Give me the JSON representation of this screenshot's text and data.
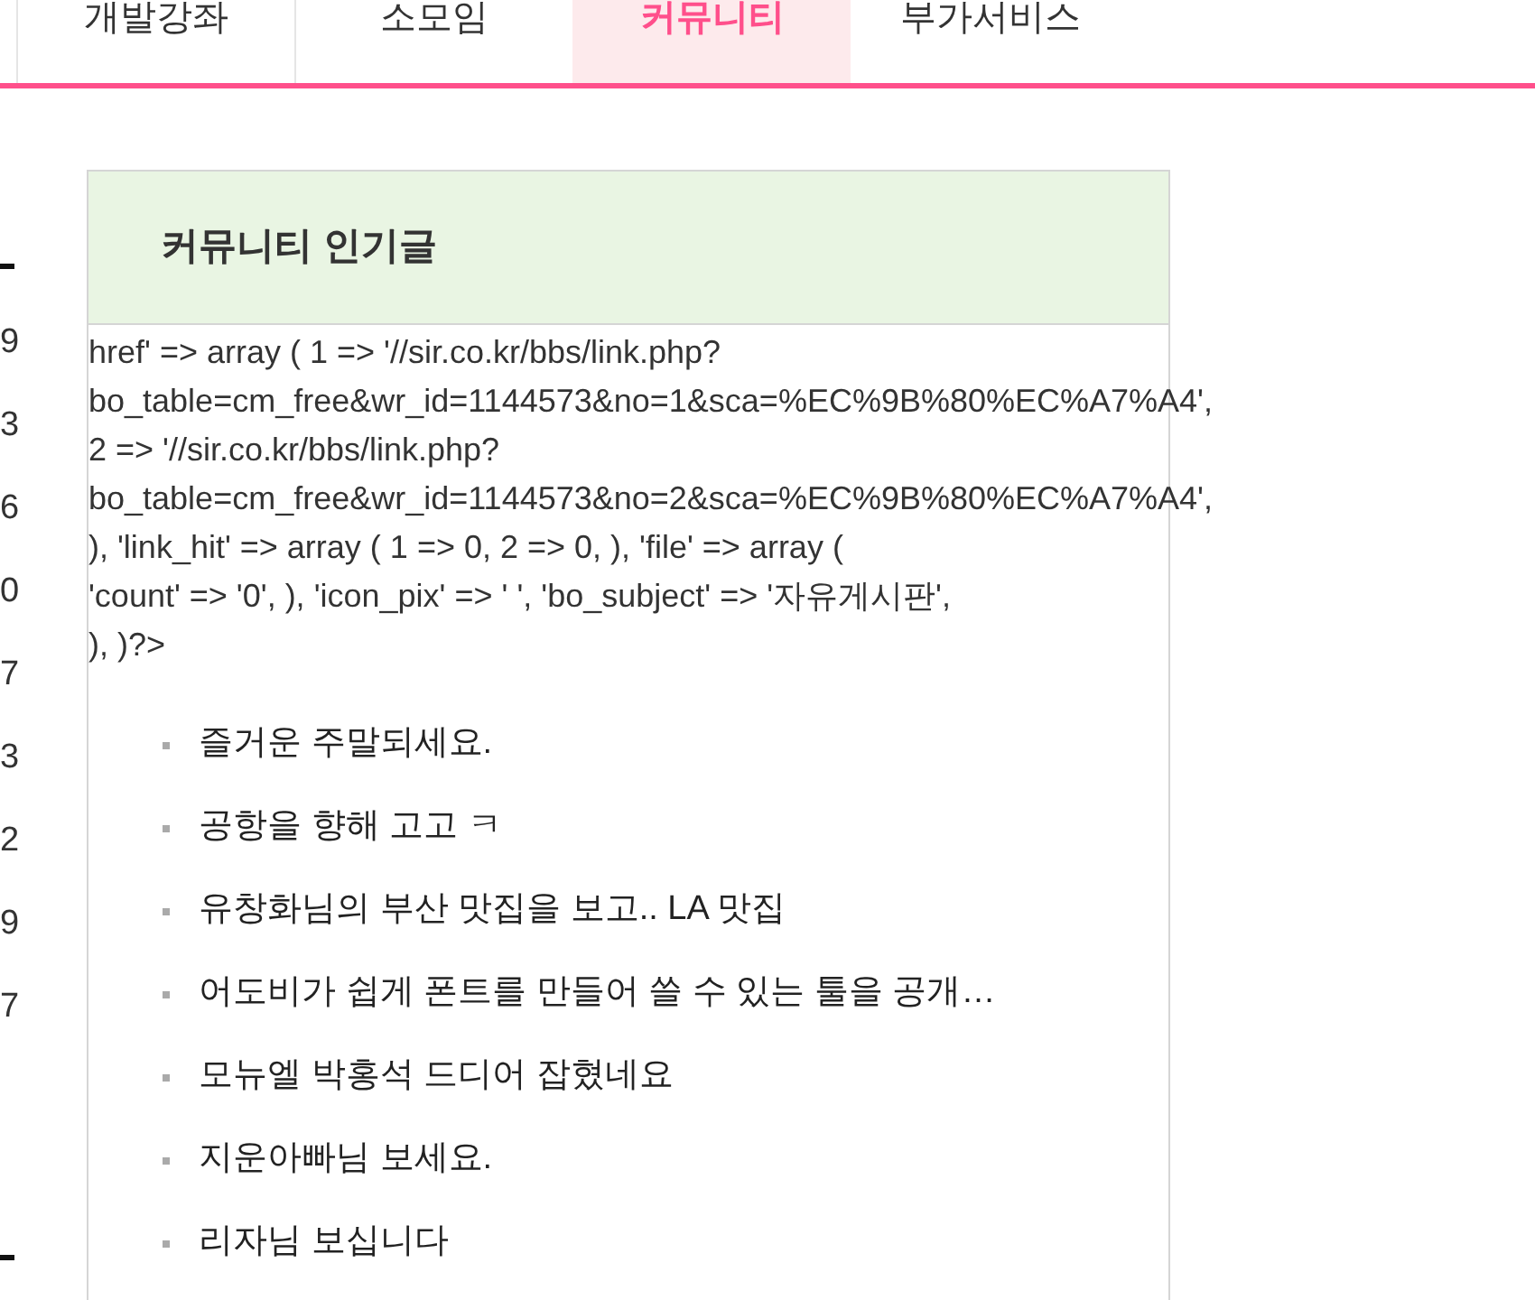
{
  "nav": {
    "tabs": [
      {
        "label": "개발강좌",
        "selected": false
      },
      {
        "label": "소모임",
        "selected": false
      },
      {
        "label": "커뮤니티",
        "selected": true
      },
      {
        "label": "부가서비스",
        "selected": false
      }
    ]
  },
  "left_column": [
    "9",
    "3",
    "6",
    "0",
    "7",
    "3",
    "2",
    "9",
    "7"
  ],
  "card": {
    "title": "커뮤니티 인기글",
    "code_lines": [
      "href' => array ( 1 => '//sir.co.kr/bbs/link.php?",
      "bo_table=cm_free&wr_id=1144573&no=1&sca=%EC%9B%80%EC%A7%A4',",
      "2 => '//sir.co.kr/bbs/link.php?",
      "bo_table=cm_free&wr_id=1144573&no=2&sca=%EC%9B%80%EC%A7%A4',",
      "), 'link_hit' => array ( 1 => 0, 2 => 0, ), 'file' => array (",
      "'count' => '0', ), 'icon_pix' => ' ', 'bo_subject' => '자유게시판',",
      "), )?>"
    ],
    "posts": [
      "즐거운 주말되세요.",
      "공항을 향해 고고 ㅋ",
      "유창화님의 부산 맛집을 보고.. LA 맛집",
      "어도비가 쉽게 폰트를 만들어 쓸 수 있는 툴을 공개…",
      "모뉴엘 박홍석 드디어 잡혔네요",
      "지운아빠님 보세요.",
      "리자님 보십니다"
    ]
  }
}
